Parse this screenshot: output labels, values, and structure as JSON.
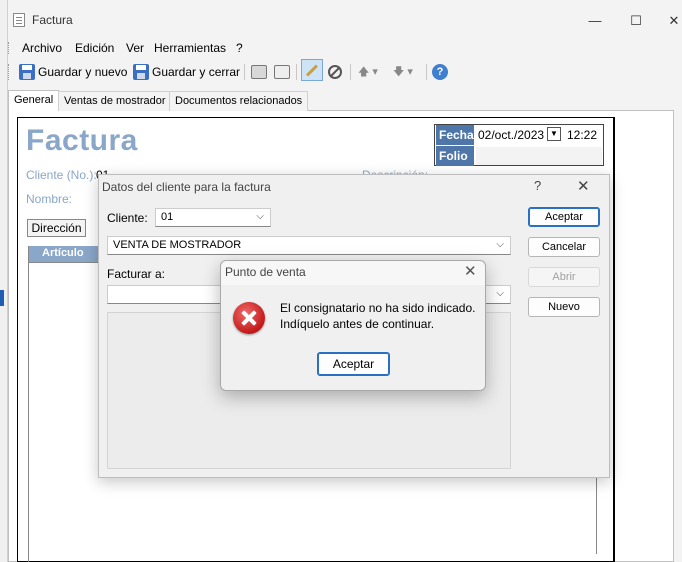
{
  "window": {
    "title": "Factura",
    "controls": {
      "minimize": "—",
      "maximize": "☐",
      "close": "✕"
    }
  },
  "menu": [
    "Archivo",
    "Edición",
    "Ver",
    "Herramientas",
    "?"
  ],
  "toolbar": {
    "save_new": "Guardar y nuevo",
    "save_close": "Guardar y cerrar"
  },
  "tabs": [
    "General",
    "Ventas de mostrador",
    "Documentos relacionados"
  ],
  "invoice": {
    "title": "Factura",
    "fecha_label": "Fecha",
    "date": "02/oct./2023",
    "time": "12:22",
    "folio_label": "Folio",
    "folio": "",
    "cliente_label": "Cliente (No.):",
    "cliente_value": "01",
    "nombre_label": "Nombre:",
    "descripcion_label": "Descripción:",
    "direccion_button": "Dirección",
    "grid_header": "Artículo"
  },
  "client_dialog": {
    "title": "Datos del cliente para la factura",
    "help": "?",
    "close": "✕",
    "cliente_label": "Cliente:",
    "cliente_value": "01",
    "name_value": "VENTA DE MOSTRADOR",
    "facturar_label": "Facturar a:",
    "facturar_value": "",
    "buttons": {
      "accept": "Aceptar",
      "cancel": "Cancelar",
      "open": "Abrir",
      "new": "Nuevo"
    }
  },
  "message_box": {
    "title": "Punto de venta",
    "close": "✕",
    "line1": "El consignatario no ha sido indicado.",
    "line2": "Indíquelo antes de continuar.",
    "button": "Aceptar",
    "icon": "error-icon"
  }
}
